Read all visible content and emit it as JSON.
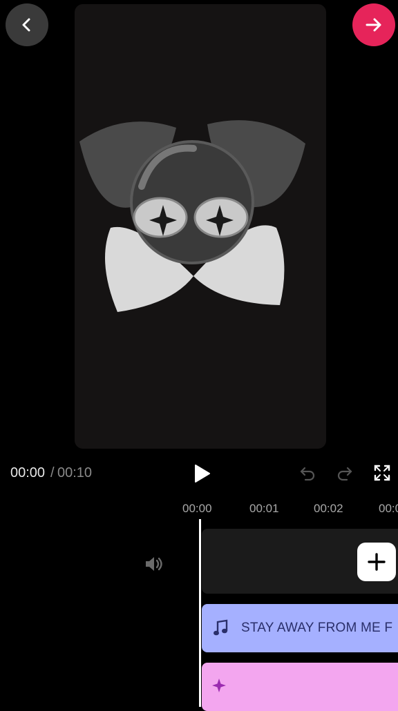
{
  "preview": {
    "artwork": "cartoon-bunny-face-icon"
  },
  "playback": {
    "current_time": "00:00",
    "separator": "/",
    "total_time": "00:10"
  },
  "timeline": {
    "ticks": [
      "00:00",
      "00:01",
      "00:02",
      "00:0"
    ]
  },
  "audio_track": {
    "title": "STAY AWAY FROM ME F"
  },
  "icons": {
    "back": "chevron-left-icon",
    "next": "arrow-right-icon",
    "play": "play-icon",
    "undo": "undo-icon",
    "redo": "redo-icon",
    "fullscreen": "fullscreen-icon",
    "volume": "volume-icon",
    "add": "plus-icon",
    "music": "music-note-icon",
    "effect": "sparkle-icon"
  },
  "colors": {
    "accent": "#e6245a",
    "audio_track": "#a5b0ff",
    "effect_track": "#f3a6ef"
  }
}
